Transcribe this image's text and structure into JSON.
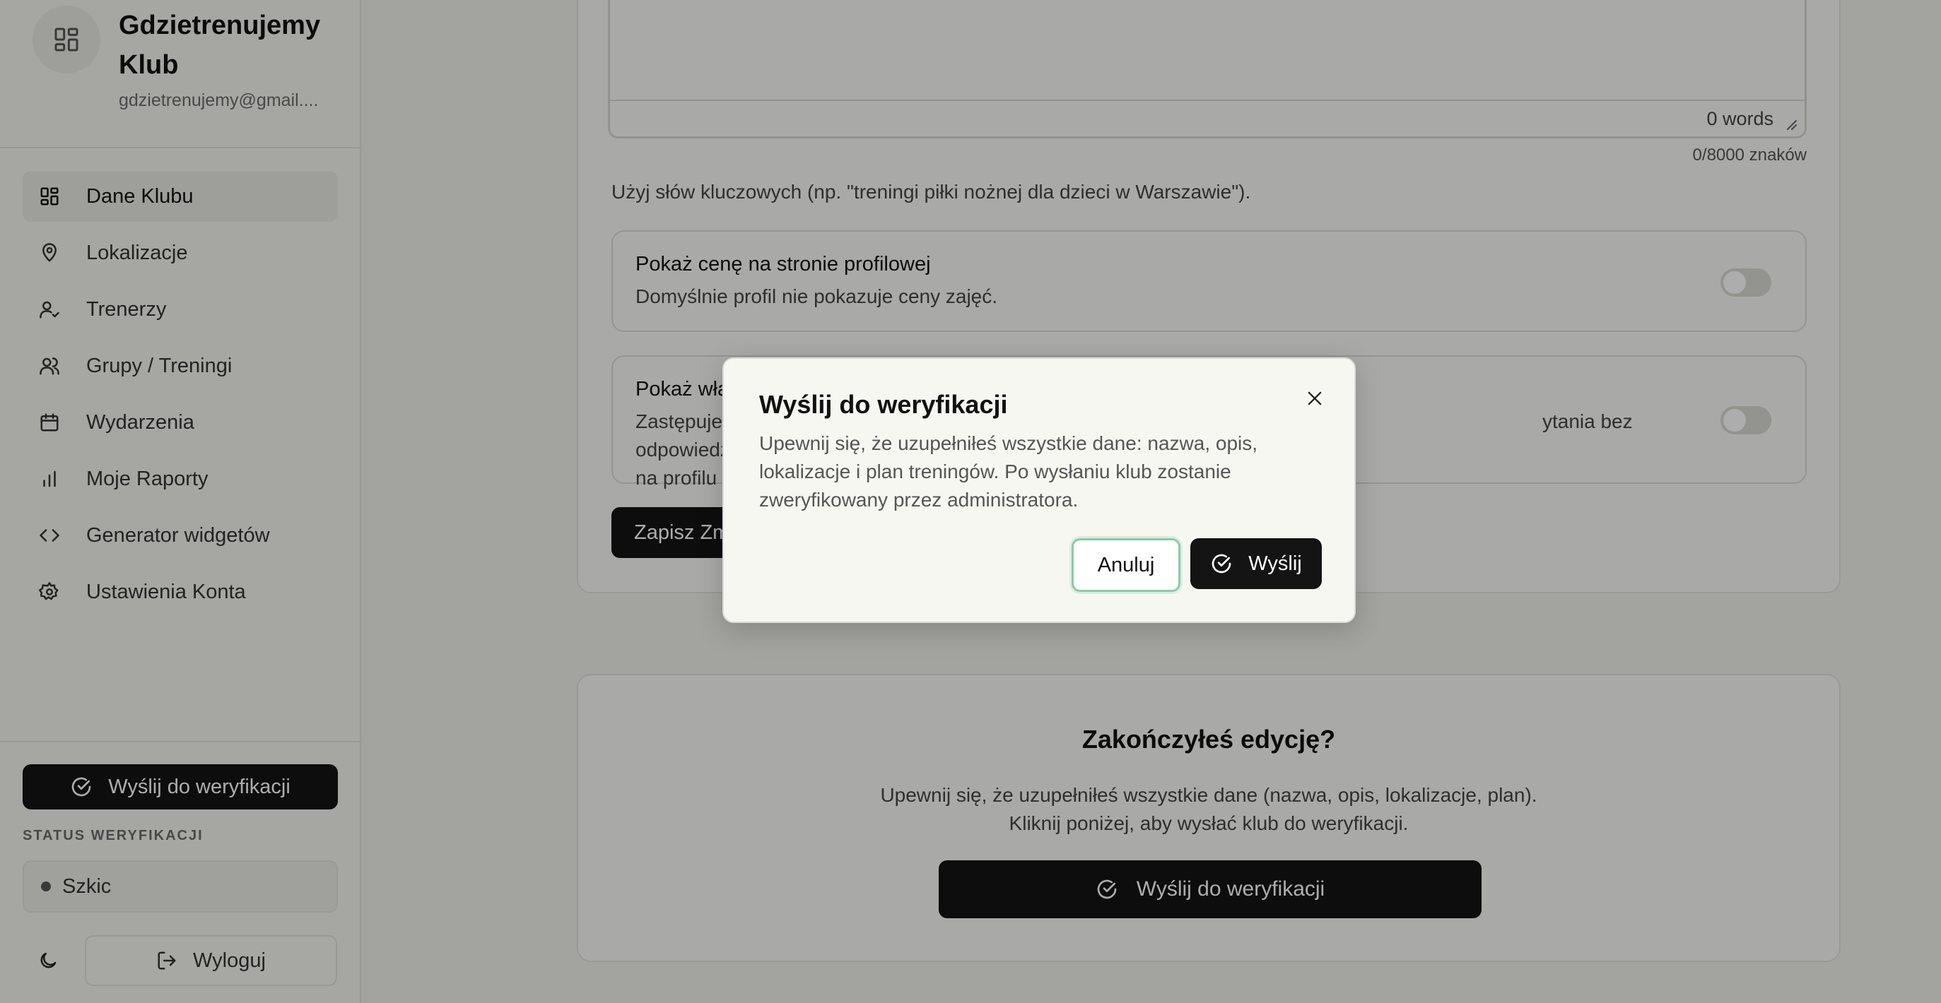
{
  "brand": {
    "name": "Gdzietrenujemy Klub",
    "email": "gdzietrenujemy@gmail...."
  },
  "sidebar": {
    "items": [
      {
        "label": "Dane Klubu",
        "icon": "dashboard-icon",
        "active": true
      },
      {
        "label": "Lokalizacje",
        "icon": "map-pin-icon"
      },
      {
        "label": "Trenerzy",
        "icon": "user-check-icon"
      },
      {
        "label": "Grupy / Treningi",
        "icon": "users-icon"
      },
      {
        "label": "Wydarzenia",
        "icon": "calendar-icon"
      },
      {
        "label": "Moje Raporty",
        "icon": "bar-chart-icon"
      },
      {
        "label": "Generator widgetów",
        "icon": "code-icon"
      },
      {
        "label": "Ustawienia Konta",
        "icon": "gear-icon"
      }
    ],
    "verify_button": "Wyślij do weryfikacji",
    "status_title": "STATUS WERYFIKACJI",
    "status_value": "Szkic",
    "logout": "Wyloguj"
  },
  "form": {
    "word_count": "0 words",
    "char_count": "0/8000 znaków",
    "hint": "Użyj słów kluczowych (np. \"treningi piłki nożnej dla dzieci w Warszawie\").",
    "price_toggle": {
      "title": "Pokaż cenę na stronie profilowej",
      "description": "Domyślnie profil nie pokazuje ceny zajęć.",
      "enabled": false
    },
    "faq_toggle": {
      "title_visible": "Pokaż wła",
      "description_start": "Zastępuje",
      "description_end": "ytania bez odpowiedzi nie pokażą się",
      "description_line2": "na profilu",
      "enabled": false
    },
    "save_button": "Zapisz Zm"
  },
  "finish_card": {
    "title": "Zakończyłeś edycję?",
    "line1": "Upewnij się, że uzupełniłeś wszystkie dane (nazwa, opis, lokalizacje, plan).",
    "line2": "Kliknij poniżej, aby wysłać klub do weryfikacji.",
    "button": "Wyślij do weryfikacji"
  },
  "dialog": {
    "title": "Wyślij do weryfikacji",
    "description": "Upewnij się, że uzupełniłeś wszystkie dane: nazwa, opis, lokalizacje i plan treningów. Po wysłaniu klub zostanie zweryfikowany przez administratora.",
    "cancel": "Anuluj",
    "submit": "Wyślij"
  }
}
